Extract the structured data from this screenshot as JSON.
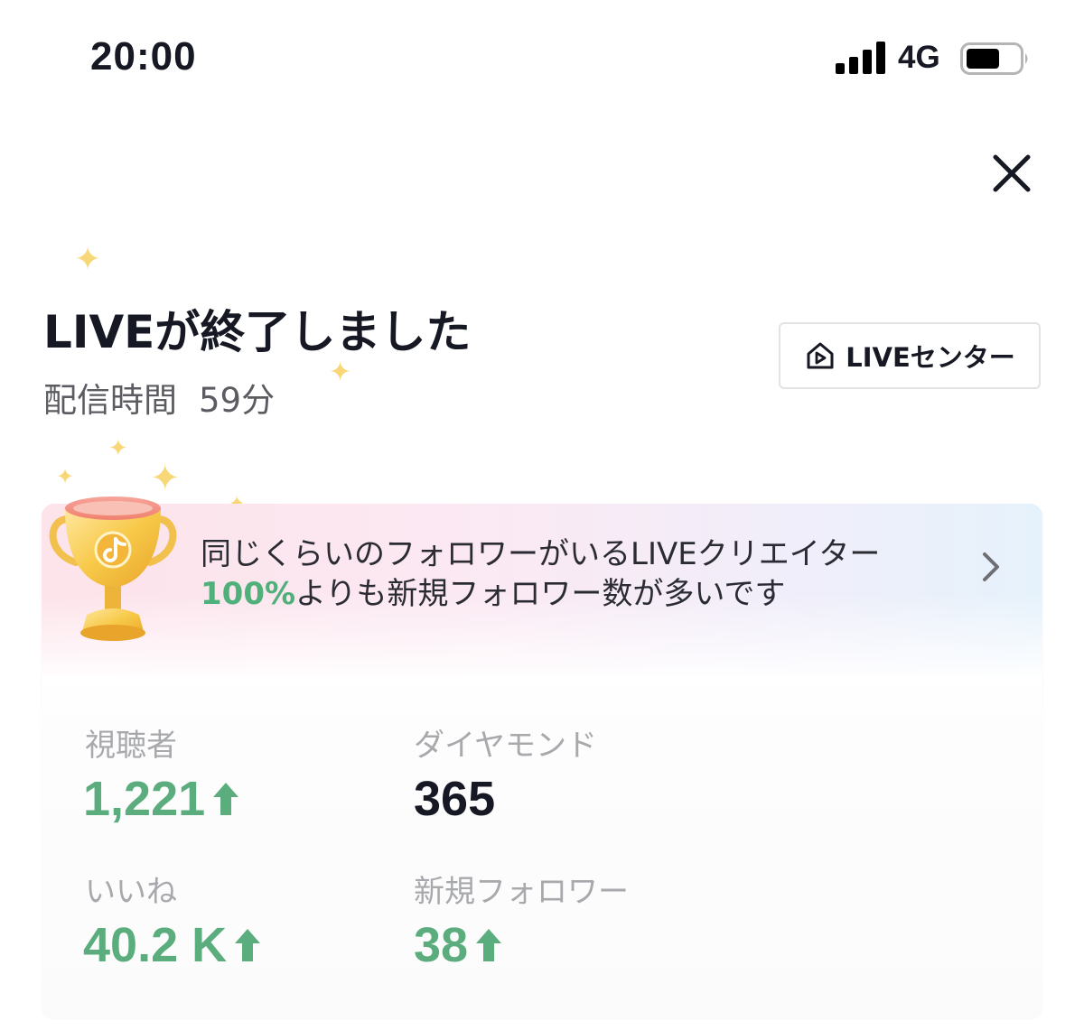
{
  "status_bar": {
    "time": "20:00",
    "network": "4G"
  },
  "header": {
    "title": "LIVEが終了しました",
    "duration_label": "配信時間",
    "duration_value": "59分",
    "center_button_label": "LIVEセンター"
  },
  "banner": {
    "text_before": "同じくらいのフォロワーがいるLIVEクリエイター",
    "text_highlight": "100%",
    "text_after": "よりも新規フォロワー数が多いです"
  },
  "stats": {
    "viewers": {
      "label": "視聴者",
      "value": "1,221"
    },
    "diamonds": {
      "label": "ダイヤモンド",
      "value": "365"
    },
    "likes": {
      "label": "いいね",
      "value": "40.2 K"
    },
    "new_followers": {
      "label": "新規フォロワー",
      "value": "38"
    }
  },
  "colors": {
    "accent_green": "#5cad7e",
    "sparkle": "#f7d777"
  },
  "icons": [
    "signal-icon",
    "battery-icon",
    "close-icon",
    "live-center-icon",
    "trophy-icon",
    "chevron-right-icon",
    "up-arrow-icon"
  ]
}
